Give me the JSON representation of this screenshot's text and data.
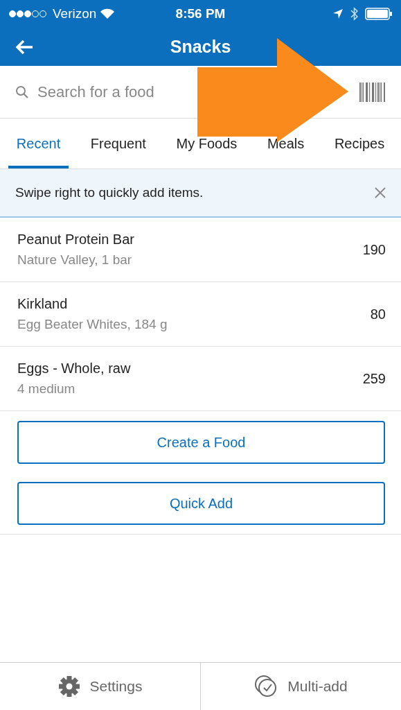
{
  "status_bar": {
    "carrier": "Verizon",
    "time": "8:56 PM"
  },
  "header": {
    "title": "Snacks"
  },
  "search": {
    "placeholder": "Search for a food"
  },
  "tabs": [
    {
      "label": "Recent",
      "selected": true
    },
    {
      "label": "Frequent",
      "selected": false
    },
    {
      "label": "My Foods",
      "selected": false
    },
    {
      "label": "Meals",
      "selected": false
    },
    {
      "label": "Recipes",
      "selected": false
    }
  ],
  "banner": {
    "text": "Swipe right to quickly add items."
  },
  "foods": [
    {
      "name": "Peanut Protein Bar",
      "detail": "Nature Valley, 1 bar",
      "calories": "190"
    },
    {
      "name": "Kirkland",
      "detail": "Egg Beater Whites, 184 g",
      "calories": "80"
    },
    {
      "name": "Eggs - Whole, raw",
      "detail": "4 medium",
      "calories": "259"
    }
  ],
  "actions": [
    "Create a Food",
    "Quick Add"
  ],
  "bottom_bar": [
    {
      "kind": "settings",
      "label": "Settings"
    },
    {
      "kind": "multi",
      "label": "Multi-add"
    }
  ]
}
